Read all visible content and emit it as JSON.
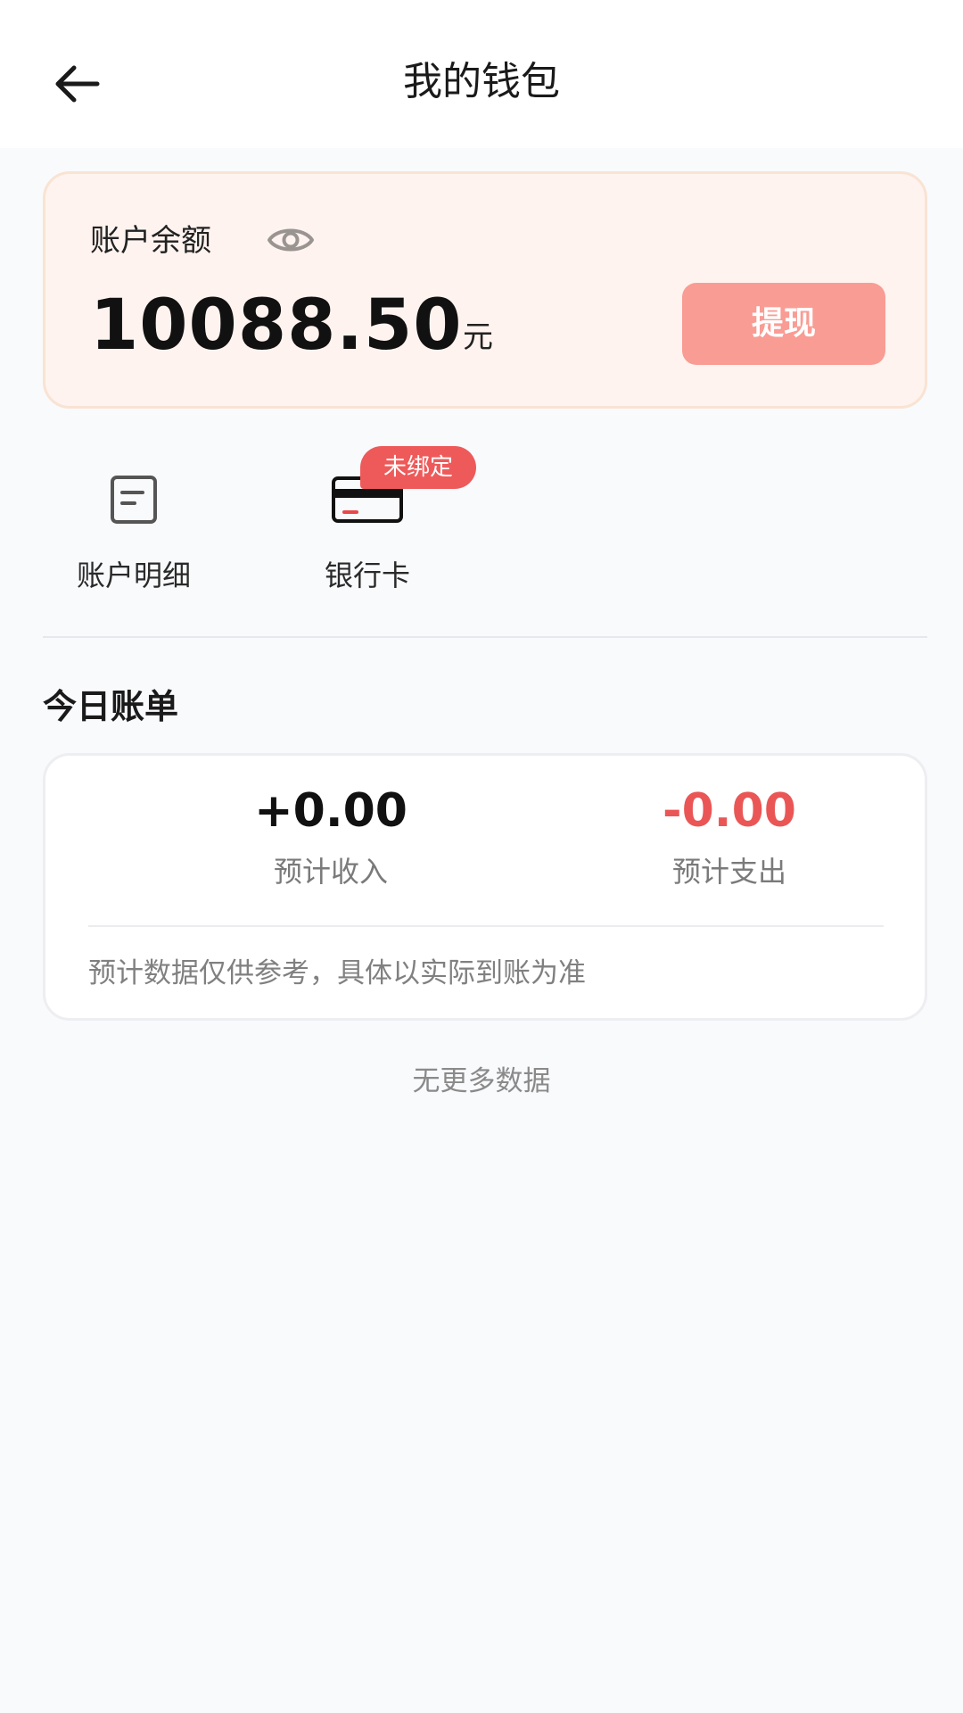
{
  "header": {
    "title": "我的钱包",
    "back_icon": "arrow-left-icon"
  },
  "balance": {
    "label": "账户余额",
    "visibility_icon": "eye-icon",
    "amount": "10088.50",
    "unit": "元",
    "withdraw_label": "提现",
    "card_color": "#fef3ef",
    "button_color": "#f99c94"
  },
  "entries": [
    {
      "label": "账户明细",
      "icon": "document-icon"
    },
    {
      "label": "银行卡",
      "icon": "bank-card-icon",
      "badge": "未绑定",
      "badge_color": "#ee5a5a"
    }
  ],
  "today_bill": {
    "title": "今日账单",
    "income_value": "+0.00",
    "income_label": "预计收入",
    "expense_value": "-0.00",
    "expense_label": "预计支出",
    "expense_color": "#ea5656",
    "note": "预计数据仅供参考，具体以实际到账为准"
  },
  "footer": {
    "no_more": "无更多数据"
  }
}
